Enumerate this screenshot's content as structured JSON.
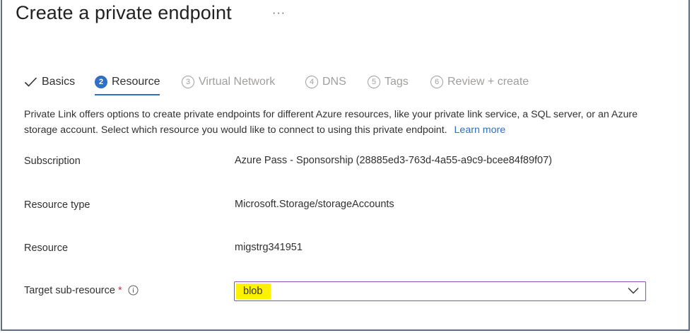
{
  "page": {
    "title": "Create a private endpoint",
    "more_label": "···"
  },
  "tabs": [
    {
      "label": "Basics",
      "state": "done",
      "number": ""
    },
    {
      "label": "Resource",
      "state": "active",
      "number": "2"
    },
    {
      "label": "Virtual Network",
      "state": "disabled",
      "number": "3"
    },
    {
      "label": "DNS",
      "state": "disabled",
      "number": "4"
    },
    {
      "label": "Tags",
      "state": "disabled",
      "number": "5"
    },
    {
      "label": "Review + create",
      "state": "disabled",
      "number": "6"
    }
  ],
  "description": {
    "text": "Private Link offers options to create private endpoints for different Azure resources, like your private link service, a SQL server, or an Azure storage account. Select which resource you would like to connect to using this private endpoint.",
    "learn_more": "Learn more"
  },
  "fields": {
    "subscription": {
      "label": "Subscription",
      "value": "Azure Pass - Sponsorship (28885ed3-763d-4a55-a9c9-bcee84f89f07)"
    },
    "resource_type": {
      "label": "Resource type",
      "value": "Microsoft.Storage/storageAccounts"
    },
    "resource": {
      "label": "Resource",
      "value": "migstrg341951"
    },
    "target_sub_resource": {
      "label": "Target sub-resource",
      "required_mark": "*",
      "value": "blob"
    }
  },
  "colors": {
    "accent": "#2f6fc4",
    "highlight": "#fff200",
    "focus_border": "#8a4ec2",
    "required": "#c4314b",
    "frame_border": "#5b6e86"
  },
  "icons": {
    "tab_done": "check-icon",
    "info": "info-icon",
    "dropdown": "chevron-down-icon",
    "more": "more-icon"
  }
}
